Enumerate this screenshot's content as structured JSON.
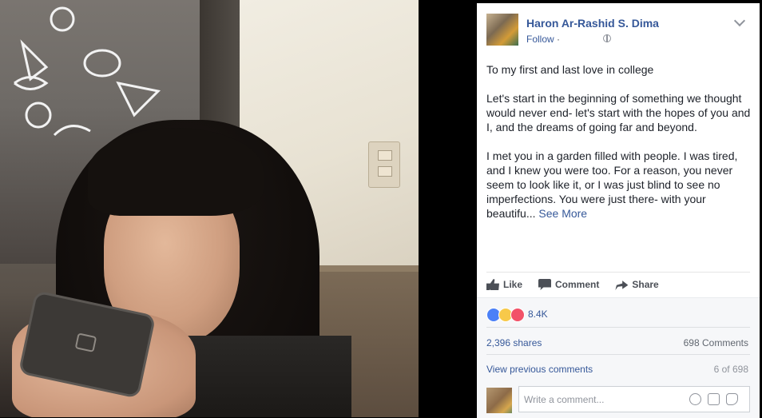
{
  "photo": {
    "description_icon": "photo-of-girl-with-phone"
  },
  "post": {
    "author": "Haron Ar-Rashid S. Dima",
    "follow_label": "Follow",
    "follow_separator": "·",
    "paragraphs": [
      "To my first and last love in college",
      "Let's start in the beginning of something we thought would never end- let's start with the hopes of you and I, and the dreams of going far and beyond.",
      "I met you in a garden filled with people. I was tired, and I knew you were too. For a reason, you never seem to look like it, or I was just blind to see no imperfections. You were just there- with your beautifu..."
    ],
    "see_more": "See More"
  },
  "actions": {
    "like": "Like",
    "comment": "Comment",
    "share": "Share"
  },
  "stats": {
    "reaction_count": "8.4K",
    "shares": "2,396 shares",
    "comments": "698 Comments",
    "view_previous": "View previous comments",
    "pages": "6 of 698"
  },
  "composer": {
    "placeholder": "Write a comment..."
  },
  "colors": {
    "link": "#365899",
    "text": "#1d2129",
    "muted": "#90949c",
    "backdrop": "#000000"
  }
}
